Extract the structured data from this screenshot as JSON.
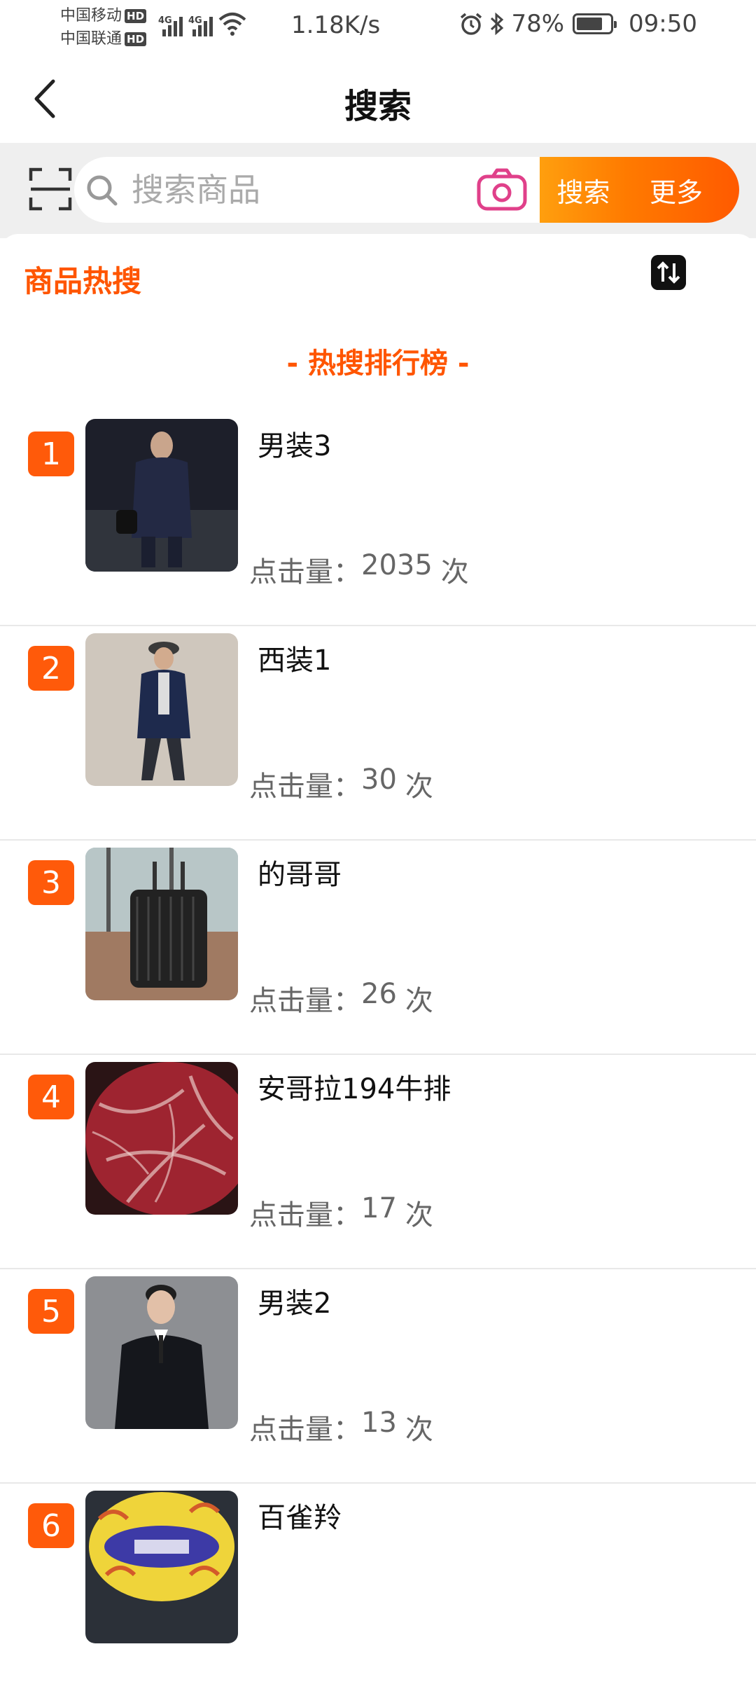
{
  "status_bar": {
    "carrier_1": "中国移动",
    "carrier_2": "中国联通",
    "hd_label": "HD",
    "network_1": "4G",
    "network_2": "4G",
    "net_speed": "1.18K/s",
    "battery_percent": "78%",
    "battery_level": 0.78,
    "time": "09:50",
    "icons": [
      "alarm-icon",
      "bluetooth-icon",
      "wifi-icon",
      "signal-icon",
      "battery-icon"
    ]
  },
  "header": {
    "title": "搜索",
    "back_icon": "chevron-left-icon"
  },
  "search": {
    "placeholder": "搜索商品",
    "search_button": "搜索",
    "more_button": "更多",
    "icons": [
      "scan-icon",
      "search-icon",
      "camera-icon"
    ]
  },
  "hot_section": {
    "title": "商品热搜",
    "ranking_heading": "- 热搜排行榜 -",
    "sort_icon": "sort-toggle-icon",
    "clicks_label": "点击量：",
    "clicks_unit": "次",
    "items": [
      {
        "rank": "1",
        "name": "男装3",
        "clicks": "2035"
      },
      {
        "rank": "2",
        "name": "西装1",
        "clicks": "30"
      },
      {
        "rank": "3",
        "name": "的哥哥",
        "clicks": "26"
      },
      {
        "rank": "4",
        "name": "安哥拉194牛排",
        "clicks": "17"
      },
      {
        "rank": "5",
        "name": "男装2",
        "clicks": "13"
      },
      {
        "rank": "6",
        "name": "百雀羚",
        "clicks": ""
      }
    ]
  },
  "colors": {
    "accent": "#ff5500",
    "badge": "#ff5a0a",
    "search_btn_start": "#ff9f0e",
    "more_btn_end": "#ff5a00",
    "camera": "#e0408a"
  }
}
